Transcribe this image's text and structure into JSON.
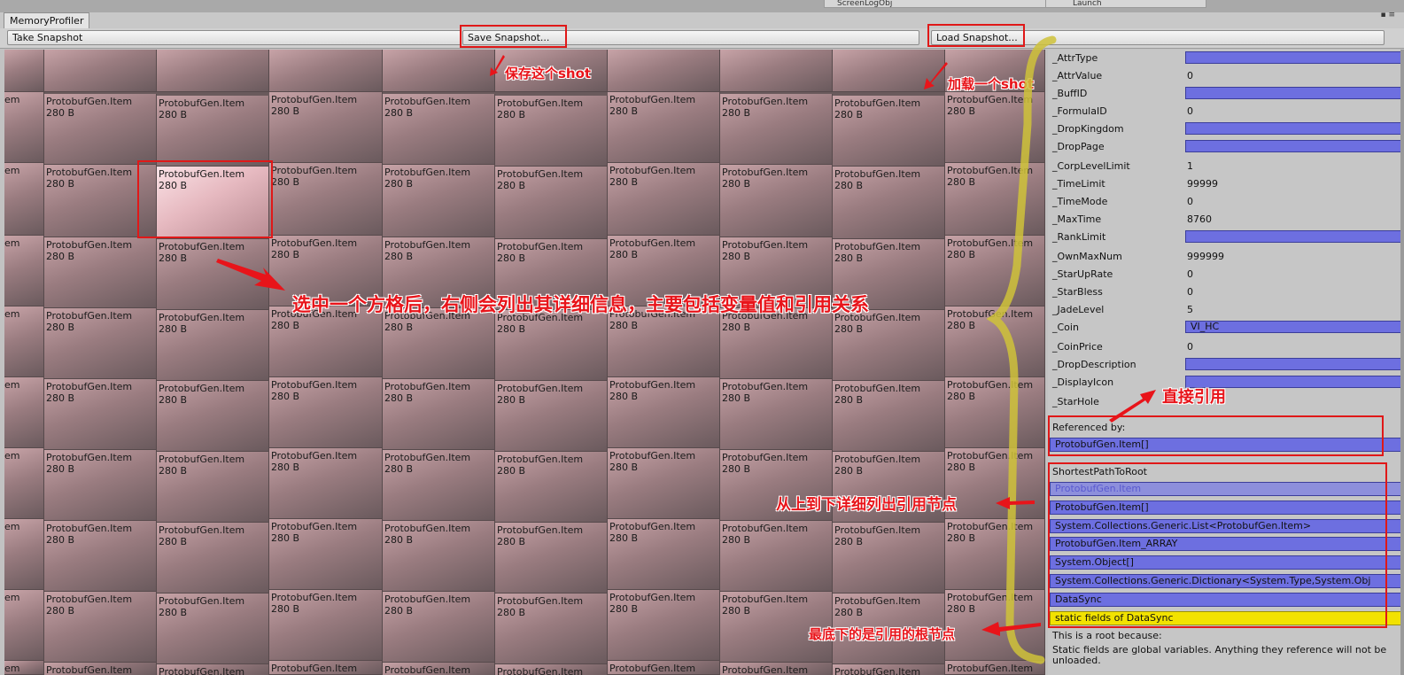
{
  "window": {
    "tab_title": "MemoryProfiler",
    "bg_tab_1": "ScreenLogObj",
    "bg_tab_2": "Launch"
  },
  "toolbar": {
    "take_label": "Take Snapshot",
    "save_label": "Save Snapshot...",
    "load_label": "Load Snapshot..."
  },
  "grid": {
    "item_name": "ProtobufGen.Item",
    "item_size": "280 B",
    "clipped_label": "em"
  },
  "fields": [
    {
      "name": "_AttrType",
      "value": "",
      "bar": true
    },
    {
      "name": "_AttrValue",
      "value": "0",
      "bar": false
    },
    {
      "name": "_BuffID",
      "value": "",
      "bar": true
    },
    {
      "name": "_FormulaID",
      "value": "0",
      "bar": false
    },
    {
      "name": "_DropKingdom",
      "value": "",
      "bar": true
    },
    {
      "name": "_DropPage",
      "value": "",
      "bar": true
    },
    {
      "name": "_CorpLevelLimit",
      "value": "1",
      "bar": false
    },
    {
      "name": "_TimeLimit",
      "value": "99999",
      "bar": false
    },
    {
      "name": "_TimeMode",
      "value": "0",
      "bar": false
    },
    {
      "name": "_MaxTime",
      "value": "8760",
      "bar": false
    },
    {
      "name": "_RankLimit",
      "value": "",
      "bar": true
    },
    {
      "name": "_OwnMaxNum",
      "value": "999999",
      "bar": false
    },
    {
      "name": "_StarUpRate",
      "value": "0",
      "bar": false
    },
    {
      "name": "_StarBless",
      "value": "0",
      "bar": false
    },
    {
      "name": "_JadeLevel",
      "value": "5",
      "bar": false
    },
    {
      "name": "_Coin",
      "value": "VI_HC",
      "bar": true
    },
    {
      "name": "_CoinPrice",
      "value": "0",
      "bar": false
    },
    {
      "name": "_DropDescription",
      "value": "",
      "bar": true
    },
    {
      "name": "_DisplayIcon",
      "value": "",
      "bar": true
    },
    {
      "name": "_StarHole",
      "value": "",
      "bar": false
    }
  ],
  "referenced_by": {
    "label": "Referenced by:",
    "items": [
      "ProtobufGen.Item[]"
    ]
  },
  "shortest_path": {
    "label": "ShortestPathToRoot",
    "items": [
      "ProtobufGen.Item",
      "ProtobufGen.Item[]",
      "System.Collections.Generic.List<ProtobufGen.Item>",
      "ProtobufGen.Item_ARRAY",
      "System.Object[]",
      "System.Collections.Generic.Dictionary<System.Type,System.Obj",
      "DataSync",
      "static fields of DataSync"
    ]
  },
  "root_reason": {
    "label": "This is a root because:",
    "text": "Static fields are global variables. Anything they reference will not be unloaded."
  },
  "annotations": {
    "save": "保存这个shot",
    "load": "加载一个shot",
    "select": "选中一个方格后，右侧会列出其详细信息，主要包括变量值和引用关系",
    "direct_ref": "直接引用",
    "path": "从上到下详细列出引用节点",
    "root": "最底下的是引用的根节点"
  },
  "colors": {
    "annotation_red": "#e8141a",
    "ref_bar": "#6d6fe0",
    "root_bar": "#f2e200",
    "brace": "#cfc23a"
  }
}
